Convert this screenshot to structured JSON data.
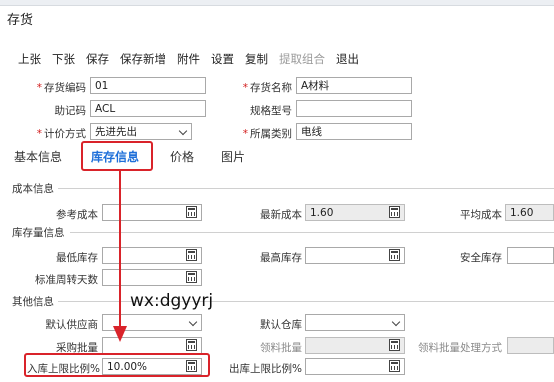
{
  "window": {
    "title": "存货"
  },
  "toolbar": [
    {
      "label": "上张",
      "enabled": true
    },
    {
      "label": "下张",
      "enabled": true
    },
    {
      "label": "保存",
      "enabled": true
    },
    {
      "label": "保存新增",
      "enabled": true
    },
    {
      "label": "附件",
      "enabled": true
    },
    {
      "label": "设置",
      "enabled": true
    },
    {
      "label": "复制",
      "enabled": true
    },
    {
      "label": "提取组合",
      "enabled": false
    },
    {
      "label": "退出",
      "enabled": true
    }
  ],
  "header": {
    "code_label": "存货编码",
    "code_value": "01",
    "name_label": "存货名称",
    "name_value": "A材料",
    "mnemonic_label": "助记码",
    "mnemonic_value": "ACL",
    "spec_label": "规格型号",
    "spec_value": "",
    "pricing_label": "计价方式",
    "pricing_value": "先进先出",
    "category_label": "所属类别",
    "category_value": "电线"
  },
  "tabs": [
    {
      "label": "基本信息",
      "active": false
    },
    {
      "label": "库存信息",
      "active": true
    },
    {
      "label": "价格",
      "active": false
    },
    {
      "label": "图片",
      "active": false
    }
  ],
  "cost": {
    "section": "成本信息",
    "ref_cost_label": "参考成本",
    "ref_cost_value": "",
    "latest_cost_label": "最新成本",
    "latest_cost_value": "1.60",
    "avg_cost_label": "平均成本",
    "avg_cost_value": "1.60"
  },
  "stock": {
    "section": "库存量信息",
    "min_label": "最低库存",
    "min_value": "",
    "max_label": "最高库存",
    "max_value": "",
    "safe_label": "安全库存",
    "safe_value": "",
    "turnover_label": "标准周转天数",
    "turnover_value": ""
  },
  "other": {
    "section": "其他信息",
    "supplier_label": "默认供应商",
    "supplier_value": "",
    "warehouse_label": "默认仓库",
    "warehouse_value": "",
    "purchase_batch_label": "采购批量",
    "purchase_batch_value": "",
    "pick_batch_label": "领料批量",
    "pick_batch_value": "",
    "pick_batch_method_label": "领料批量处理方式",
    "pick_batch_method_value": "",
    "in_limit_label": "入库上限比例%",
    "in_limit_value": "10.00%",
    "out_limit_label": "出库上限比例%",
    "out_limit_value": ""
  },
  "watermark": "wx:dgyyrj",
  "colors": {
    "active_tab": "#1e6fd9",
    "highlight_red": "#d9232a",
    "required": "#d21b1b"
  }
}
